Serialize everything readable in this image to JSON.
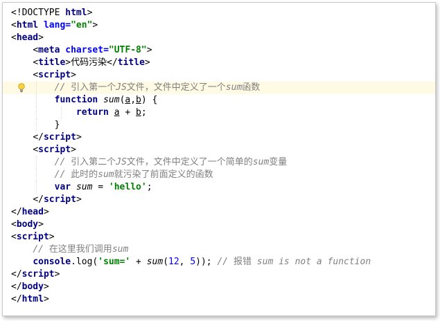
{
  "editor": {
    "lines": [
      {
        "indent": 0,
        "tokens": [
          {
            "t": "<!DOCTYPE ",
            "c": ""
          },
          {
            "t": "html",
            "c": "tag"
          },
          {
            "t": ">",
            "c": ""
          }
        ]
      },
      {
        "indent": 0,
        "tokens": [
          {
            "t": "<",
            "c": ""
          },
          {
            "t": "html ",
            "c": "tag"
          },
          {
            "t": "lang=",
            "c": "attr"
          },
          {
            "t": "\"en\"",
            "c": "str"
          },
          {
            "t": ">",
            "c": ""
          }
        ]
      },
      {
        "indent": 0,
        "tokens": [
          {
            "t": "<",
            "c": ""
          },
          {
            "t": "head",
            "c": "tag"
          },
          {
            "t": ">",
            "c": ""
          }
        ]
      },
      {
        "indent": 1,
        "tokens": [
          {
            "t": "<",
            "c": ""
          },
          {
            "t": "meta ",
            "c": "tag"
          },
          {
            "t": "charset=",
            "c": "attr"
          },
          {
            "t": "\"UTF-8\"",
            "c": "str"
          },
          {
            "t": ">",
            "c": ""
          }
        ]
      },
      {
        "indent": 1,
        "tokens": [
          {
            "t": "<",
            "c": ""
          },
          {
            "t": "title",
            "c": "tag"
          },
          {
            "t": ">",
            "c": ""
          },
          {
            "t": "代码污染",
            "c": "cjk"
          },
          {
            "t": "</",
            "c": ""
          },
          {
            "t": "title",
            "c": "tag"
          },
          {
            "t": ">",
            "c": ""
          }
        ]
      },
      {
        "indent": 1,
        "tokens": [
          {
            "t": "<",
            "c": ""
          },
          {
            "t": "script",
            "c": "tag"
          },
          {
            "t": ">",
            "c": ""
          }
        ]
      },
      {
        "indent": 2,
        "current": true,
        "bulb": true,
        "tokens": [
          {
            "t": "// ",
            "c": "cmt"
          },
          {
            "t": "引入第一个",
            "c": "cmt cjk"
          },
          {
            "t": "JS",
            "c": "cmt"
          },
          {
            "t": "文件，文件中定义了一个",
            "c": "cmt cjk"
          },
          {
            "t": "sum",
            "c": "cmt"
          },
          {
            "t": "函数",
            "c": "cmt cjk"
          }
        ]
      },
      {
        "indent": 2,
        "tokens": [
          {
            "t": "function ",
            "c": "kw"
          },
          {
            "t": "sum",
            "c": "ital"
          },
          {
            "t": "(",
            "c": ""
          },
          {
            "t": "a",
            "c": "ref"
          },
          {
            "t": ",",
            "c": ""
          },
          {
            "t": "b",
            "c": "ref"
          },
          {
            "t": ") {",
            "c": ""
          }
        ]
      },
      {
        "indent": 3,
        "tokens": [
          {
            "t": "return ",
            "c": "kw"
          },
          {
            "t": "a",
            "c": "ref"
          },
          {
            "t": " + ",
            "c": ""
          },
          {
            "t": "b",
            "c": "ref"
          },
          {
            "t": ";",
            "c": ""
          }
        ]
      },
      {
        "indent": 2,
        "tokens": [
          {
            "t": "}",
            "c": ""
          }
        ]
      },
      {
        "indent": 1,
        "tokens": [
          {
            "t": "</",
            "c": ""
          },
          {
            "t": "script",
            "c": "tag"
          },
          {
            "t": ">",
            "c": ""
          }
        ]
      },
      {
        "indent": 1,
        "tokens": [
          {
            "t": "<",
            "c": ""
          },
          {
            "t": "script",
            "c": "tag"
          },
          {
            "t": ">",
            "c": ""
          }
        ]
      },
      {
        "indent": 2,
        "tokens": [
          {
            "t": "// ",
            "c": "cmt"
          },
          {
            "t": "引入第二个",
            "c": "cmt cjk"
          },
          {
            "t": "JS",
            "c": "cmt"
          },
          {
            "t": "文件，文件中定义了一个简单的",
            "c": "cmt cjk"
          },
          {
            "t": "sum",
            "c": "cmt"
          },
          {
            "t": "变量",
            "c": "cmt cjk"
          }
        ]
      },
      {
        "indent": 2,
        "tokens": [
          {
            "t": "// ",
            "c": "cmt"
          },
          {
            "t": "此时的",
            "c": "cmt cjk"
          },
          {
            "t": "sum",
            "c": "cmt"
          },
          {
            "t": "就污染了前面定义的函数",
            "c": "cmt cjk"
          }
        ]
      },
      {
        "indent": 2,
        "tokens": [
          {
            "t": "var ",
            "c": "kw"
          },
          {
            "t": "sum",
            "c": "ital"
          },
          {
            "t": " = ",
            "c": ""
          },
          {
            "t": "'hello'",
            "c": "str"
          },
          {
            "t": ";",
            "c": ""
          }
        ]
      },
      {
        "indent": 1,
        "tokens": [
          {
            "t": "</",
            "c": ""
          },
          {
            "t": "script",
            "c": "tag"
          },
          {
            "t": ">",
            "c": ""
          }
        ]
      },
      {
        "indent": 0,
        "tokens": [
          {
            "t": "</",
            "c": ""
          },
          {
            "t": "head",
            "c": "tag"
          },
          {
            "t": ">",
            "c": ""
          }
        ]
      },
      {
        "indent": 0,
        "tokens": [
          {
            "t": "<",
            "c": ""
          },
          {
            "t": "body",
            "c": "tag"
          },
          {
            "t": ">",
            "c": ""
          }
        ]
      },
      {
        "indent": 0,
        "tokens": [
          {
            "t": "<",
            "c": ""
          },
          {
            "t": "script",
            "c": "tag"
          },
          {
            "t": ">",
            "c": ""
          }
        ]
      },
      {
        "indent": 1,
        "tokens": [
          {
            "t": "// ",
            "c": "cmt"
          },
          {
            "t": "在这里我们调用",
            "c": "cmt cjk"
          },
          {
            "t": "sum",
            "c": "cmt"
          }
        ]
      },
      {
        "indent": 1,
        "tokens": [
          {
            "t": "console",
            "c": "kw"
          },
          {
            "t": ".",
            "c": ""
          },
          {
            "t": "log",
            "c": ""
          },
          {
            "t": "(",
            "c": ""
          },
          {
            "t": "'sum='",
            "c": "str"
          },
          {
            "t": " + ",
            "c": ""
          },
          {
            "t": "sum",
            "c": "ital"
          },
          {
            "t": "(",
            "c": ""
          },
          {
            "t": "12",
            "c": "num"
          },
          {
            "t": ", ",
            "c": ""
          },
          {
            "t": "5",
            "c": "num"
          },
          {
            "t": ")); ",
            "c": ""
          },
          {
            "t": "// ",
            "c": "cmt"
          },
          {
            "t": "报错",
            "c": "cmt cjk"
          },
          {
            "t": " sum is not a function",
            "c": "cmt"
          }
        ]
      },
      {
        "indent": 0,
        "tokens": [
          {
            "t": "</",
            "c": ""
          },
          {
            "t": "script",
            "c": "tag"
          },
          {
            "t": ">",
            "c": ""
          }
        ]
      },
      {
        "indent": 0,
        "tokens": [
          {
            "t": "</",
            "c": ""
          },
          {
            "t": "body",
            "c": "tag"
          },
          {
            "t": ">",
            "c": ""
          }
        ]
      },
      {
        "indent": 0,
        "tokens": [
          {
            "t": "</",
            "c": ""
          },
          {
            "t": "html",
            "c": "tag"
          },
          {
            "t": ">",
            "c": ""
          }
        ]
      }
    ],
    "bulb_icon": "lightbulb-icon",
    "colors": {
      "tag": "#000080",
      "attribute": "#0000ff",
      "string": "#008000",
      "keyword": "#000080",
      "comment": "#808080",
      "number": "#0000ff",
      "current_line": "#fffae3"
    }
  }
}
